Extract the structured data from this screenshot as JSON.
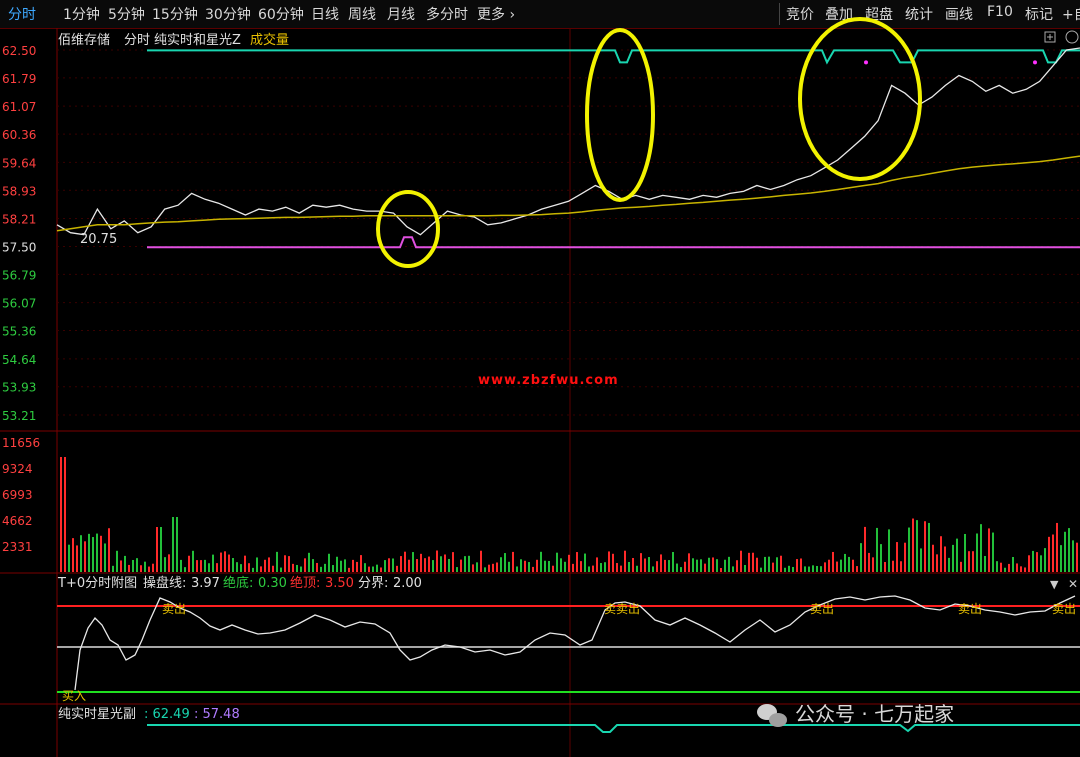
{
  "toolbar": {
    "tabs": [
      "分时",
      "1分钟",
      "5分钟",
      "15分钟",
      "30分钟",
      "60分钟",
      "日线",
      "周线",
      "月线",
      "多分时",
      "更多 ›"
    ],
    "right_tabs": [
      "竞价",
      "叠加",
      "超盘",
      "统计",
      "画线",
      "F10",
      "标记",
      "+自"
    ]
  },
  "main_panel": {
    "stock_name": "佰维存储",
    "mode": "分时",
    "indicator": "纯实时和星光Z",
    "volume_label": "成交量",
    "ticks": [
      "62.50",
      "61.79",
      "61.07",
      "60.36",
      "59.64",
      "58.93",
      "58.21",
      "57.50",
      "56.79",
      "56.07",
      "55.36",
      "54.64",
      "53.93",
      "53.21"
    ],
    "tick_colors": {
      "up": "#ff4040",
      "base": "#e0e0e0",
      "down": "#2ecc40"
    },
    "bottom_marker": "20.75",
    "watermark": "www.zbzfwu.com"
  },
  "volume_panel": {
    "ticks": [
      "11656",
      "9324",
      "6993",
      "4662",
      "2331"
    ]
  },
  "t0_panel": {
    "title": "T+0分时附图",
    "field1_label": "操盘线:",
    "field1_value": "3.97",
    "field2_label": "绝底:",
    "field2_value": "0.30",
    "field3_label": "绝顶:",
    "field3_value": "3.50",
    "field4_label": "分界:",
    "field4_value": "2.00",
    "buy_label": "买入",
    "sell_label": "卖出",
    "sell_label_2": "卖卖出"
  },
  "sub_panel": {
    "title": "纯实时星光副",
    "value1": ": 62.49",
    "value2": ": 57.48"
  },
  "footer": {
    "wechat_text": "公众号 · 七万起家"
  },
  "chart_data": {
    "type": "line",
    "title": "佰维存储 分时",
    "ylim": [
      53.21,
      62.5
    ],
    "ticks": [
      62.5,
      61.79,
      61.07,
      60.36,
      59.64,
      58.93,
      58.21,
      57.5,
      56.79,
      56.07,
      55.36,
      54.64,
      53.93,
      53.21
    ],
    "series": [
      {
        "name": "price",
        "color": "#e8e8e8",
        "values": [
          58.05,
          57.85,
          57.8,
          58.45,
          57.95,
          58.15,
          57.85,
          58.0,
          58.45,
          58.55,
          58.85,
          58.7,
          58.6,
          58.45,
          58.3,
          58.45,
          58.4,
          58.5,
          58.35,
          58.55,
          58.5,
          58.55,
          58.45,
          58.4,
          58.4,
          58.35,
          58.0,
          57.8,
          58.1,
          58.4,
          58.3,
          58.25,
          58.05,
          58.1,
          58.2,
          58.3,
          58.45,
          58.55,
          58.65,
          58.85,
          59.05,
          58.9,
          58.7,
          58.8,
          58.7,
          58.8,
          58.75,
          58.7,
          58.8,
          58.75,
          58.85,
          58.9,
          59.05,
          58.95,
          59.05,
          59.2,
          59.3,
          59.5,
          59.7,
          60.0,
          60.3,
          60.7,
          61.6,
          61.4,
          61.1,
          61.3,
          61.6,
          61.85,
          61.7,
          61.45,
          61.6,
          61.4,
          61.5,
          61.7,
          62.1,
          62.5,
          62.55
        ]
      },
      {
        "name": "avg",
        "color": "#c8b400",
        "values": [
          57.9,
          57.95,
          58.0,
          58.05,
          58.05,
          58.05,
          58.08,
          58.1,
          58.12,
          58.13,
          58.15,
          58.17,
          58.19,
          58.2,
          58.21,
          58.22,
          58.23,
          58.24,
          58.24,
          58.25,
          58.26,
          58.27,
          58.27,
          58.28,
          58.28,
          58.28,
          58.28,
          58.28,
          58.28,
          58.28,
          58.28,
          58.28,
          58.28,
          58.29,
          58.29,
          58.3,
          58.31,
          58.33,
          58.35,
          58.38,
          58.42,
          58.45,
          58.48,
          58.5,
          58.52,
          58.55,
          58.57,
          58.6,
          58.62,
          58.65,
          58.68,
          58.7,
          58.73,
          58.76,
          58.8,
          58.83,
          58.86,
          58.9,
          58.95,
          59.0,
          59.05,
          59.1,
          59.18,
          59.25,
          59.3,
          59.36,
          59.42,
          59.48,
          59.52,
          59.55,
          59.58,
          59.6,
          59.63,
          59.66,
          59.7,
          59.75,
          59.8
        ]
      }
    ],
    "upper_band": 62.49,
    "lower_band": 57.48,
    "volume": {
      "ylim": [
        0,
        11656
      ],
      "ticks": [
        11656,
        9324,
        6993,
        4662,
        2331
      ]
    }
  },
  "colors": {
    "cyan_band": "#19d6b0",
    "magenta_band": "#e050e0",
    "highlight_circle": "#f2f200",
    "grid_red": "#5a0000",
    "red_line": "#ff2020",
    "green_line": "#20e020"
  }
}
